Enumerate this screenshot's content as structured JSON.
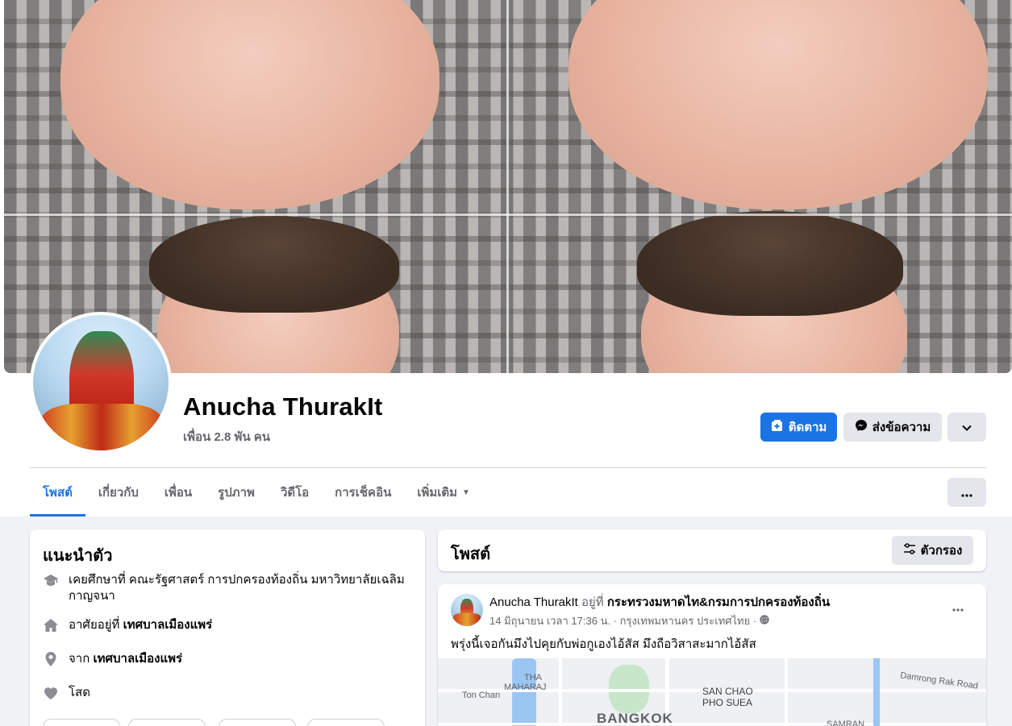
{
  "profile": {
    "name": "Anucha ThurakIt",
    "friends": "เพื่อน 2.8 พัน คน"
  },
  "actions": {
    "follow_label": "ติดตาม",
    "message_label": "ส่งข้อความ"
  },
  "tabs": [
    {
      "label": "โพสต์",
      "active": true
    },
    {
      "label": "เกี่ยวกับ"
    },
    {
      "label": "เพื่อน"
    },
    {
      "label": "รูปภาพ"
    },
    {
      "label": "วิดีโอ"
    },
    {
      "label": "การเช็คอิน"
    },
    {
      "label": "เพิ่มเติม"
    }
  ],
  "intro": {
    "title": "แนะนำตัว",
    "education_line1": "เคยศึกษาที่ คณะรัฐศาสตร์ การปกครองท้องถิ่น มหาวิทยาลัยเฉลิม",
    "education_line2": "กาญจนา",
    "lives_prefix": "อาศัยอยู่ที่",
    "lives_place": "เทศบาลเมืองแพร่",
    "from_prefix": "จาก",
    "from_place": "เทศบาลเมืองแพร่",
    "relationship": "โสด"
  },
  "posts_section": {
    "title": "โพสต์",
    "filter_label": "ตัวกรอง"
  },
  "post": {
    "author": "Anucha ThurakIt",
    "at_word": "อยู่ที่",
    "place": "กระทรวงมหาดไท&กรมการปกครองท้องถิ่น",
    "meta": "14 มิถุนายน เวลา 17:36 น. · กรุงเทพมหานคร ประเทศไทย ·",
    "text": "พรุ่งนี้เจอกันมึงไปคุยกับพ่อกูเองไอ้สัส มึงถือวิสาสะมากไอ้สัส"
  },
  "map": {
    "label_tha": "THA",
    "label_maharaj": "MAHARAJ",
    "label_ton_chan": "Ton Chan",
    "label_san_chao": "SAN CHAO",
    "label_pho_suea": "PHO SUEA",
    "label_bangkok": "BANGKOK",
    "label_damrong": "Damrong Rak Road",
    "label_samran": "SAMRAN"
  },
  "icons": {
    "follow": "follow-plus-icon",
    "message": "messenger-icon",
    "chevron": "chevron-down-icon",
    "more": "more-dots-icon",
    "filter": "filter-sliders-icon",
    "education": "graduation-cap-icon",
    "home": "home-icon",
    "location": "location-pin-icon",
    "relationship": "heart-icon",
    "privacy": "globe-icon"
  },
  "colors": {
    "accent": "#1b74e4",
    "secondary_button": "#e4e6eb",
    "page_bg": "#f0f2f5",
    "muted_text": "#65676b"
  }
}
